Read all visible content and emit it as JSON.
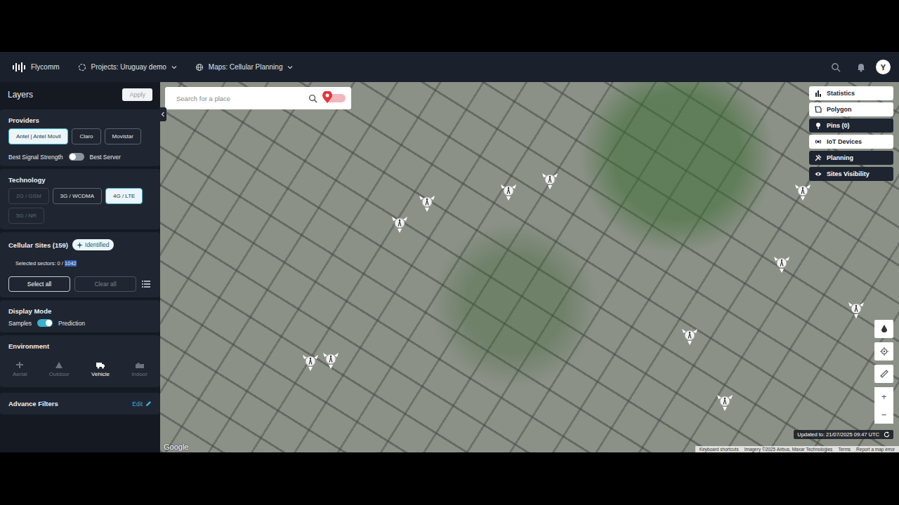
{
  "app": {
    "name": "Flycomm",
    "project": "Projects: Uruguay demo",
    "map": "Maps: Cellular Planning",
    "avatar": "Y"
  },
  "layers": {
    "title": "Layers",
    "apply": "Apply"
  },
  "providers": {
    "title": "Providers",
    "items": [
      {
        "label": "Antel | Antel Movil",
        "selected": true
      },
      {
        "label": "Claro",
        "selected": false
      },
      {
        "label": "Movistar",
        "selected": false
      }
    ],
    "toggle": {
      "left": "Best Signal Strength",
      "right": "Best Server",
      "on": false
    }
  },
  "technology": {
    "title": "Technology",
    "items": [
      {
        "label": "2G / GSM",
        "selected": false,
        "disabled": true
      },
      {
        "label": "3G / WCDMA",
        "selected": false,
        "disabled": false
      },
      {
        "label": "4G / LTE",
        "selected": true,
        "disabled": false
      },
      {
        "label": "5G / NR",
        "selected": false,
        "disabled": true
      }
    ]
  },
  "sites": {
    "title": "Cellular Sites (159)",
    "badge": "Identified",
    "selected_label": "Selected sectors: 0 / ",
    "total": "1042",
    "total_highlighted": true,
    "select_all": "Select all",
    "clear_all": "Clear all"
  },
  "display_mode": {
    "title": "Display Mode",
    "left": "Samples",
    "right": "Prediction",
    "on": true
  },
  "environment": {
    "title": "Environment",
    "items": [
      {
        "label": "Aerial",
        "selected": false
      },
      {
        "label": "Outdoor",
        "selected": false
      },
      {
        "label": "Vehicle",
        "selected": true
      },
      {
        "label": "Indoor",
        "selected": false
      }
    ]
  },
  "advanced": {
    "title": "Advance Filters",
    "edit": "Edit"
  },
  "map": {
    "search_placeholder": "Search for a place",
    "pin_toggle_on": false,
    "tools": [
      {
        "label": "Statistics",
        "selected": false
      },
      {
        "label": "Polygon",
        "selected": false
      },
      {
        "label": "Pins (0)",
        "selected": true
      },
      {
        "label": "IoT Devices",
        "selected": false
      },
      {
        "label": "Planning",
        "selected": true
      },
      {
        "label": "Sites Visibility",
        "selected": true
      }
    ],
    "zoom_in": "+",
    "zoom_out": "−",
    "updated": "Updated to: 21/07/2025 09:47 UTC",
    "logo": "Google",
    "attribution": [
      "Keyboard shortcuts",
      "Imagery ©2025 Airbus, Maxar Technologies",
      "Terms",
      "Report a map error"
    ]
  }
}
